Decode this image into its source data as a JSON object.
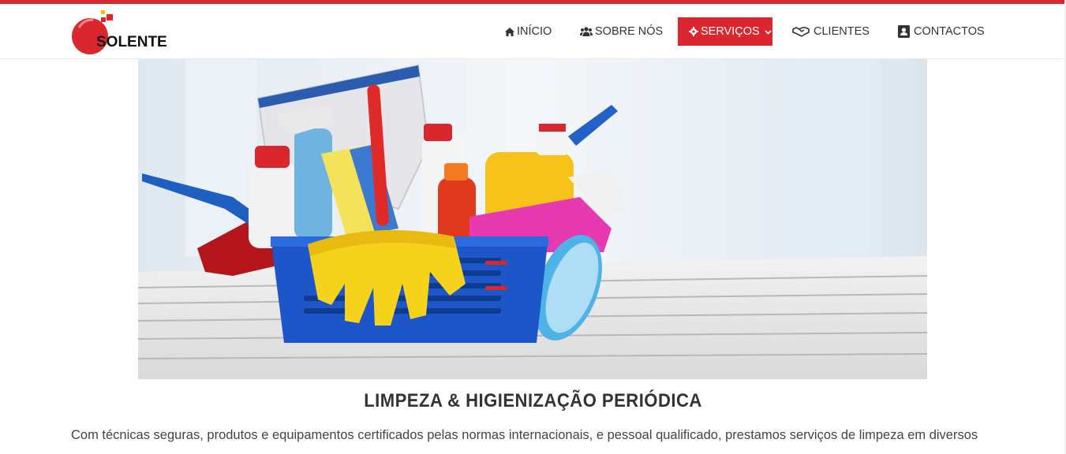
{
  "brand": {
    "name": "SOLENTE"
  },
  "nav": {
    "items": [
      {
        "label": "INÍCIO",
        "icon": "home-icon"
      },
      {
        "label": "SOBRE NÓS",
        "icon": "users-icon"
      },
      {
        "label": "SERVIÇOS",
        "icon": "gear-icon",
        "active": true
      },
      {
        "label": "CLIENTES",
        "icon": "handshake-icon"
      },
      {
        "label": "CONTACTOS",
        "icon": "contact-card-icon"
      }
    ]
  },
  "main": {
    "title": "LIMPEZA & HIGIENIZAÇÃO PERIÓDICA",
    "description": "Com técnicas seguras, produtos e equipamentos certificados pelas normas internacionais, e pessoal qualificado, prestamos serviços de limpeza em diversos"
  },
  "colors": {
    "accent": "#d9272d",
    "text": "#333333"
  }
}
